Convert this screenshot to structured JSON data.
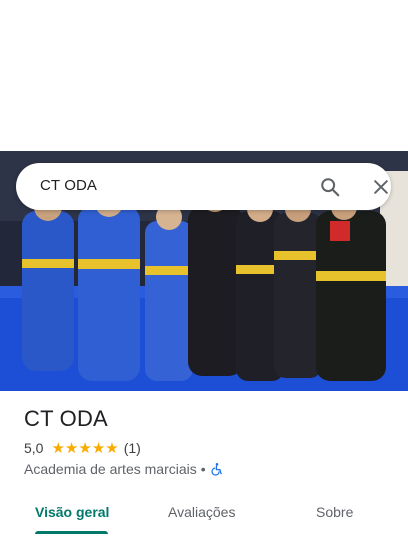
{
  "search": {
    "query": "CT ODA"
  },
  "place": {
    "name": "CT ODA",
    "rating": "5,0",
    "stars": 5,
    "review_count": "(1)",
    "category": "Academia de artes marciais",
    "separator": "•"
  },
  "tabs": [
    {
      "label": "Visão geral",
      "active": true
    },
    {
      "label": "Avaliações",
      "active": false
    },
    {
      "label": "Sobre",
      "active": false
    }
  ],
  "colors": {
    "accent": "#00796b",
    "star": "#f9ab00",
    "accessible_icon": "#1a73e8"
  },
  "icons": {
    "search": "search-icon",
    "close": "close-icon",
    "accessible": "wheelchair-icon"
  }
}
